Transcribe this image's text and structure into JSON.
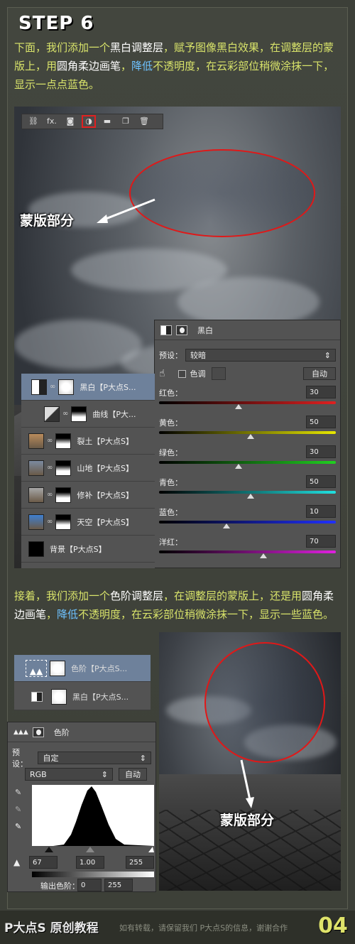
{
  "step": {
    "title": "STEP 6"
  },
  "intro": {
    "part1": "下面，我们添加一个",
    "part2": "黑白调整层",
    "part3": "，赋予图像黑白效果，在调整层的蒙版上，用",
    "part4": "圆角柔边画笔",
    "part5": "，",
    "part6": "降低",
    "part7": "不透明度，在云彩部位稍微涂抹一下，显示一点点蓝色。"
  },
  "toolbar1": {
    "icons": [
      "link-icon",
      "fx-icon",
      "mask-icon",
      "adjustment-icon",
      "folder-icon",
      "new-layer-icon",
      "trash-icon"
    ],
    "fx_label": "fx."
  },
  "annotations": {
    "mask_label_1": "蒙版部分",
    "mask_label_2": "蒙版部分"
  },
  "bw_panel": {
    "title": "黑白",
    "preset_label": "预设：",
    "preset_value": "较暗",
    "tint_label": "色调",
    "auto_label": "自动",
    "sliders": [
      {
        "label": "红色：",
        "value": "30",
        "ratio": 0.45,
        "gradient": "linear-gradient(90deg,#000,#e02020)"
      },
      {
        "label": "黄色：",
        "value": "50",
        "ratio": 0.52,
        "gradient": "linear-gradient(90deg,#000,#e8e800)"
      },
      {
        "label": "绿色：",
        "value": "30",
        "ratio": 0.45,
        "gradient": "linear-gradient(90deg,#000,#20d020)"
      },
      {
        "label": "青色：",
        "value": "50",
        "ratio": 0.52,
        "gradient": "linear-gradient(90deg,#000,#20e0e0)"
      },
      {
        "label": "蓝色：",
        "value": "10",
        "ratio": 0.38,
        "gradient": "linear-gradient(90deg,#000,#2030ff)"
      },
      {
        "label": "洋红：",
        "value": "70",
        "ratio": 0.59,
        "gradient": "linear-gradient(90deg,#000,#e020e0)"
      }
    ]
  },
  "layers": [
    {
      "name": "黑白【P大点S...",
      "type": "bw",
      "selected": true
    },
    {
      "name": "曲线【P大...",
      "type": "curves",
      "selected": false
    },
    {
      "name": "裂土【P大点S】",
      "type": "img",
      "selected": false
    },
    {
      "name": "山地【P大点S】",
      "type": "img",
      "selected": false
    },
    {
      "name": "修补【P大点S】",
      "type": "img",
      "selected": false
    },
    {
      "name": "天空【P大点S】",
      "type": "img",
      "selected": false
    },
    {
      "name": "背景【P大点S】",
      "type": "bg",
      "selected": false
    }
  ],
  "second": {
    "part1": "接着，我们添加一个",
    "part2": "色阶调整层",
    "part3": "，在调整层的蒙版上，还是用",
    "part4": "圆角柔边画笔",
    "part5": "，",
    "part6": "降低",
    "part7": "不透明度，在云彩部位稍微涂抹一下，显示一些蓝色。"
  },
  "small_layers": [
    {
      "name": "色阶【P大点S...",
      "selected": true
    },
    {
      "name": "黑白【P大点S...",
      "selected": false
    }
  ],
  "levels_panel": {
    "title": "色阶",
    "preset_label": "预设：",
    "preset_value": "自定",
    "channel": "RGB",
    "auto_label": "自动",
    "input_black": "67",
    "input_gamma": "1.00",
    "input_white": "255",
    "output_label": "输出色阶：",
    "output_black": "0",
    "output_white": "255"
  },
  "footer": {
    "brand": "P大点S 原创教程",
    "note": "如有转载，请保留我们 P大点S的信息，谢谢合作",
    "page": "04"
  }
}
